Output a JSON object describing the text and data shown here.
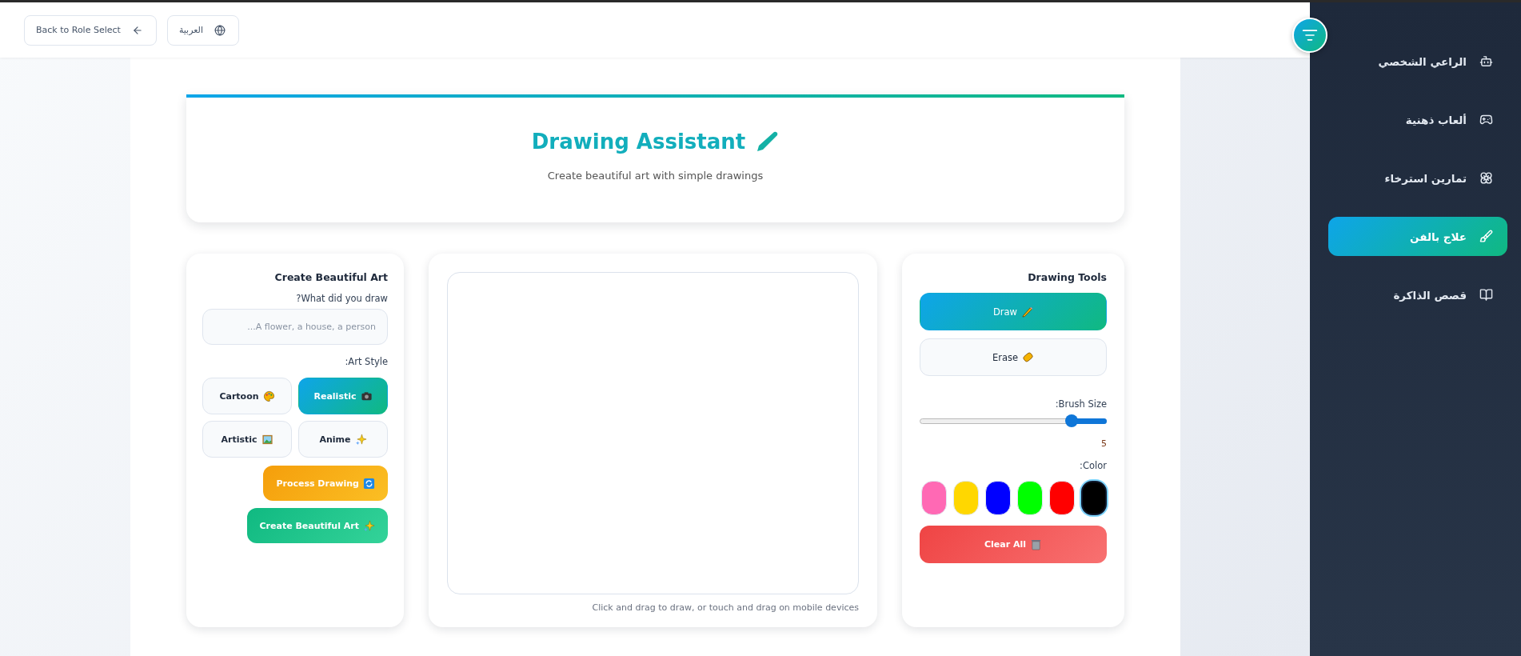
{
  "top_bar": {
    "back_button": "Back to Role Select",
    "language_button": "العربية"
  },
  "sidebar": {
    "items": [
      {
        "label": "الراعي الشخصي",
        "selected": false
      },
      {
        "label": "ألعاب ذهنية",
        "selected": false
      },
      {
        "label": "تمارين استرخاء",
        "selected": false
      },
      {
        "label": "علاج بالفن",
        "selected": true
      },
      {
        "label": "قصص الذاكرة",
        "selected": false
      }
    ]
  },
  "header": {
    "title": "Drawing Assistant",
    "subtitle": "Create beautiful art with simple drawings"
  },
  "art_panel": {
    "title": "Create Beautiful Art",
    "prompt_label": "What did you draw?",
    "prompt_placeholder": "A flower, a house, a person...",
    "style_label": "Art Style:",
    "styles": [
      {
        "label": "Cartoon",
        "selected": false
      },
      {
        "label": "Realistic",
        "selected": true
      },
      {
        "label": "Artistic",
        "selected": false
      },
      {
        "label": "Anime",
        "selected": false
      }
    ],
    "process_button": "Process Drawing",
    "create_button": "Create Beautiful Art"
  },
  "canvas_panel": {
    "hint": "Click and drag to draw, or touch and drag on mobile devices"
  },
  "tools_panel": {
    "title": "Drawing Tools",
    "tools": [
      {
        "label": "Draw",
        "selected": true
      },
      {
        "label": "Erase",
        "selected": false
      }
    ],
    "brush_label": "Brush Size:",
    "brush": {
      "level": 0.19,
      "reading": "5"
    },
    "color_label": "Color:",
    "colors": [
      {
        "color": "#000000",
        "selected": true
      },
      {
        "color": "#ff0000",
        "selected": false
      },
      {
        "color": "#00ff00",
        "selected": false
      },
      {
        "color": "#0000ff",
        "selected": false
      },
      {
        "color": "#ffd700",
        "selected": false
      },
      {
        "color": "#ff69b4",
        "selected": false
      }
    ],
    "clear_button": "Clear All"
  }
}
